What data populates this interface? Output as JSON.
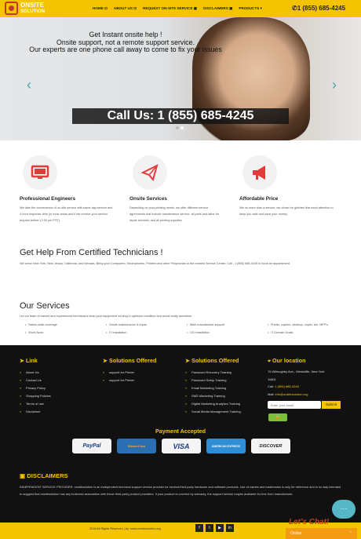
{
  "header": {
    "logo_line1": "ONSITE",
    "logo_line2": "SOLUTION",
    "nav": [
      "HOME ⊡",
      "ABOUT US ⊡",
      "REQUEST ON-SITE SERVICE ▣",
      "DISCLAIMERS ▣",
      "PRODUCTS ▾"
    ],
    "phone": "✆1 (855) 685-4245"
  },
  "hero": {
    "line1": "Get Instant onsite help !",
    "line2": "Onsite support, not a remote support service.",
    "line3": "Our experts are one phone call away to come to fix your issues",
    "banner": "Call Us: 1 (855) 685-4245",
    "prev": "‹",
    "next": "›"
  },
  "features": [
    {
      "title": "Professional Engineers",
      "text": "We take the convenience of on-site service with same-day service and 4-hour response time (in most areas and if we receive your service request before 12:00 pm PST)."
    },
    {
      "title": "Onsite Services",
      "text": "Depending on your printing needs, we offer different service agreements that include maintenance service, all parts and labor for repair services, and all printing supplies."
    },
    {
      "title": "Affordable Price",
      "text": "We do more than a service, we chose for glitches that need attention to keep you safe and save your money."
    }
  ],
  "help": {
    "title": "Get Help From Certified Technicians !",
    "text": "We serve New York, New Jersey, California, and Nevada. Bring your Computers, Smartphones, Printers and other Peripherals to the nearest Service Center. Call - 1 (855) 685-4245 to book an appointment."
  },
  "services": {
    "title": "Our Services",
    "text": "Let our team of trained and experienced technicians keep your equipment running in optimum condition and avoid costly downtime.",
    "items": [
      "Nation-wide coverage",
      "Onsite maintenance & repair",
      "Multi-manufacture support",
      "Printer, copiers, desktop, copier, fax, MFP's",
      "Short-Noon",
      "IT Installation",
      "OS Installation",
      "IT Domain Goals"
    ]
  },
  "footer": {
    "link_title": "Link",
    "links": [
      "About Us",
      "Contact Us",
      "Privacy Policy",
      "Shopping Policies",
      "Terms of use",
      "Disclaimer"
    ],
    "sol1_title": "Solutions Offered",
    "sol1": [
      "support for Printer",
      "support for Printer"
    ],
    "sol2_title": "Solutions Offered",
    "sol2": [
      "Password Recovery Training",
      "Password Setup Training",
      "Email Marketing Training",
      "SMS Marketing Training",
      "Digital Marketing Analytics Training",
      "Social Media Management Training"
    ],
    "loc_title": "Our location",
    "address1": "76 Willoughby Ave., Westcliffe, New York",
    "address2": "11801",
    "call_label": "Call:",
    "call_value": "1 (855) 685-4245",
    "mail_label": "Mail:",
    "mail_value": "info@onsitesolution.org",
    "email_placeholder": "Enter your email",
    "submit": "Submit",
    "payment_title": "Payment Accepted",
    "cards": [
      "PayPal",
      "MasterCard",
      "VISA",
      "AMERICAN EXPRESS",
      "DISCOVER"
    ]
  },
  "disclaimer": {
    "title": "DISCLAIMERS",
    "text": "INDEPENDENT SERVICE PROVIDER: onsitesolution is an independent technical support service provider for several third-party hardware and software products. Use of names and trademarks is only for reference and in no way intended to suggest that onsitesolution has any business association with these third-party product providers. If your product is covered by warranty, the support service maybe available for free from manufacturer."
  },
  "bottom": {
    "copyright": "2018 All Rights Reserved | by: www.onsitesolution.org",
    "social": [
      "f",
      "t",
      "▶",
      "in"
    ]
  },
  "chat": {
    "bubble": "···",
    "text": "Let's Chat!",
    "bar": "Online"
  }
}
